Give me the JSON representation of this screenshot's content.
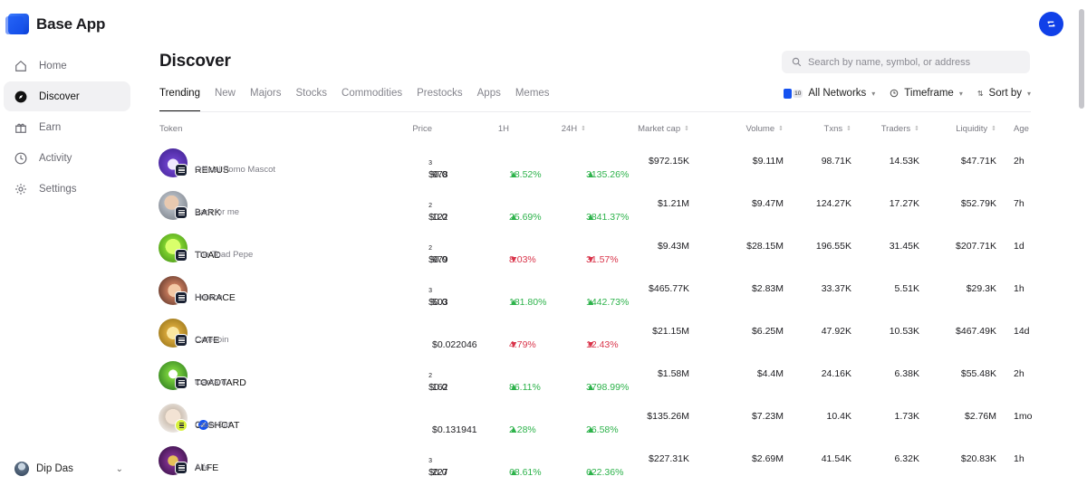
{
  "app": {
    "name": "Base App"
  },
  "sidebar": {
    "items": [
      {
        "label": "Home",
        "icon": "home-icon",
        "active": false
      },
      {
        "label": "Discover",
        "icon": "compass-icon",
        "active": true
      },
      {
        "label": "Earn",
        "icon": "gift-icon",
        "active": false
      },
      {
        "label": "Activity",
        "icon": "clock-icon",
        "active": false
      },
      {
        "label": "Settings",
        "icon": "gear-icon",
        "active": false
      }
    ],
    "user": {
      "name": "Dip Das"
    }
  },
  "page": {
    "title": "Discover"
  },
  "search": {
    "placeholder": "Search by name, symbol, or address"
  },
  "tabs": [
    "Trending",
    "New",
    "Majors",
    "Stocks",
    "Commodities",
    "Prestocks",
    "Apps",
    "Memes"
  ],
  "filters": {
    "networks_count": "10",
    "networks": "All Networks",
    "timeframe": "Timeframe",
    "sort": "Sort by"
  },
  "columns": {
    "token": "Token",
    "price": "Price",
    "h1": "1H",
    "h24": "24H",
    "market_cap": "Market cap",
    "volume": "Volume",
    "txns": "Txns",
    "traders": "Traders",
    "liquidity": "Liquidity",
    "age": "Age"
  },
  "colors": {
    "accent": "#1040e8",
    "up": "#2cb24a",
    "down": "#d9344a"
  },
  "tokens": [
    {
      "symbol": "REMUS",
      "name": "Official Fomo Mascot",
      "price_prefix": "$0.0",
      "price_sub": "3",
      "price_rest": "978",
      "h1": "18.52%",
      "h1_dir": "up",
      "h24": "3135.26%",
      "h24_dir": "up",
      "market_cap": "$972.15K",
      "volume": "$9.11M",
      "txns": "98.71K",
      "traders": "14.53K",
      "liquidity": "$47.71K",
      "age": "2h",
      "verified": false
    },
    {
      "symbol": "BARK",
      "name": "Bark for me",
      "price_prefix": "$0.0",
      "price_sub": "2",
      "price_rest": "122",
      "h1": "25.69%",
      "h1_dir": "up",
      "h24": "3841.37%",
      "h24_dir": "up",
      "market_cap": "$1.21M",
      "volume": "$9.47M",
      "txns": "124.27K",
      "traders": "17.27K",
      "liquidity": "$52.79K",
      "age": "7h",
      "verified": false
    },
    {
      "symbol": "TOAD",
      "name": "The Toad Pepe",
      "price_prefix": "$0.0",
      "price_sub": "2",
      "price_rest": "979",
      "h1": "8.03%",
      "h1_dir": "down",
      "h24": "31.57%",
      "h24_dir": "down",
      "market_cap": "$9.43M",
      "volume": "$28.15M",
      "txns": "196.55K",
      "traders": "31.45K",
      "liquidity": "$207.71K",
      "age": "1d",
      "verified": false
    },
    {
      "symbol": "HORACE",
      "name": "Horace",
      "price_prefix": "$0.0",
      "price_sub": "3",
      "price_rest": "503",
      "h1": "181.80%",
      "h1_dir": "up",
      "h24": "1442.73%",
      "h24_dir": "up",
      "market_cap": "$465.77K",
      "volume": "$2.83M",
      "txns": "33.37K",
      "traders": "5.51K",
      "liquidity": "$29.3K",
      "age": "1h",
      "verified": false
    },
    {
      "symbol": "CATE",
      "name": "Catecoin",
      "price_prefix": "$0.022046",
      "price_sub": "",
      "price_rest": "",
      "h1": "4.79%",
      "h1_dir": "down",
      "h24": "12.43%",
      "h24_dir": "down",
      "market_cap": "$21.15M",
      "volume": "$6.25M",
      "txns": "47.92K",
      "traders": "10.53K",
      "liquidity": "$467.49K",
      "age": "14d",
      "verified": false
    },
    {
      "symbol": "TOADTARD",
      "name": "toadtard",
      "price_prefix": "$0.0",
      "price_sub": "2",
      "price_rest": "162",
      "h1": "86.11%",
      "h1_dir": "up",
      "h24": "3798.99%",
      "h24_dir": "up",
      "market_cap": "$1.58M",
      "volume": "$4.4M",
      "txns": "24.16K",
      "traders": "6.38K",
      "liquidity": "$55.48K",
      "age": "2h",
      "verified": false
    },
    {
      "symbol": "CASHCAT",
      "name": "Cash Cat",
      "price_prefix": "$0.131941",
      "price_sub": "",
      "price_rest": "",
      "h1": "2.28%",
      "h1_dir": "up",
      "h24": "26.58%",
      "h24_dir": "up",
      "market_cap": "$135.26M",
      "volume": "$7.23M",
      "txns": "10.4K",
      "traders": "1.73K",
      "liquidity": "$2.76M",
      "age": "1mo",
      "verified": true
    },
    {
      "symbol": "ALFE",
      "name": "Alfe",
      "price_prefix": "$0.0",
      "price_sub": "3",
      "price_rest": "227",
      "h1": "68.61%",
      "h1_dir": "up",
      "h24": "622.36%",
      "h24_dir": "up",
      "market_cap": "$227.31K",
      "volume": "$2.69M",
      "txns": "41.54K",
      "traders": "6.32K",
      "liquidity": "$20.83K",
      "age": "1h",
      "verified": false
    }
  ]
}
